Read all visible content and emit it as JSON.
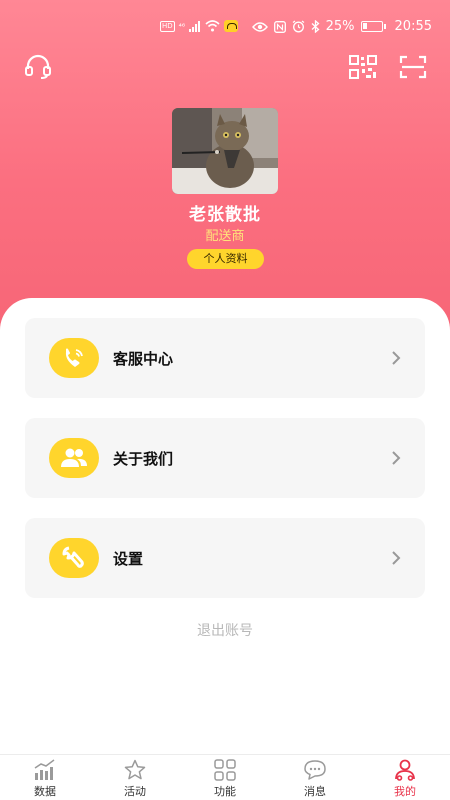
{
  "status_bar": {
    "hd": "HD",
    "network": "⁴⁶",
    "battery_text": "25%",
    "battery_level": 0.25,
    "time": "20:55"
  },
  "header": {
    "left_icon": "headset-icon",
    "right_icons": [
      "qrcode-icon",
      "scan-icon"
    ]
  },
  "profile": {
    "name": "老张散批",
    "role": "配送商",
    "button_label": "个人资料"
  },
  "menu": [
    {
      "label": "客服中心",
      "icon": "phone-icon"
    },
    {
      "label": "关于我们",
      "icon": "users-icon"
    },
    {
      "label": "设置",
      "icon": "wrench-icon"
    }
  ],
  "logout_label": "退出账号",
  "bottom_nav": [
    {
      "label": "数据",
      "icon": "chart-icon",
      "active": false
    },
    {
      "label": "活动",
      "icon": "star-icon",
      "active": false
    },
    {
      "label": "功能",
      "icon": "grid-icon",
      "active": false
    },
    {
      "label": "消息",
      "icon": "message-icon",
      "active": false
    },
    {
      "label": "我的",
      "icon": "user-icon",
      "active": true
    }
  ],
  "colors": {
    "header_top": "#ff8795",
    "header_bottom": "#f76677",
    "accent_yellow": "#ffd52c",
    "active_red": "#e8334a"
  }
}
